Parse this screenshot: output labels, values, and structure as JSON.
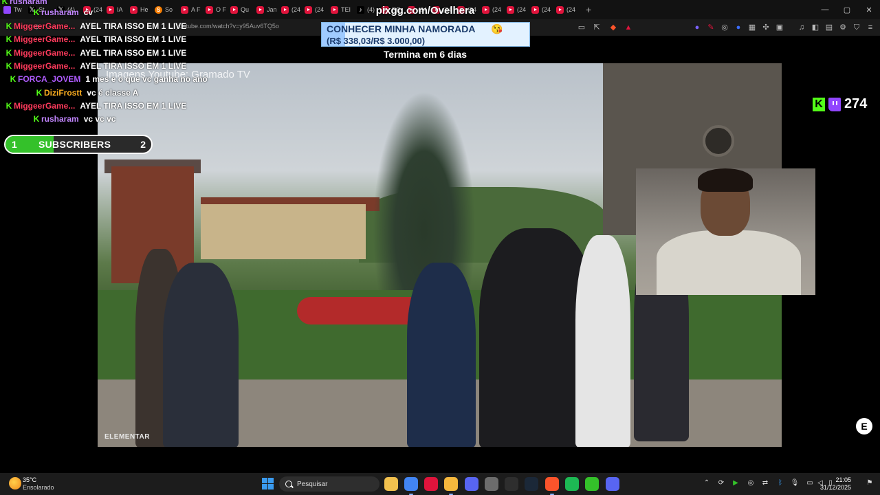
{
  "browser": {
    "tabs": [
      {
        "icon": "tw",
        "label": "Tw"
      },
      {
        "icon": "x",
        "label": "St"
      },
      {
        "icon": "x",
        "label": "(4)"
      },
      {
        "icon": "yt",
        "label": "(24"
      },
      {
        "icon": "yt",
        "label": "IA"
      },
      {
        "icon": "yt",
        "label": "He"
      },
      {
        "icon": "s",
        "label": "So"
      },
      {
        "icon": "yt",
        "label": "A F"
      },
      {
        "icon": "yt",
        "label": "O F"
      },
      {
        "icon": "yt",
        "label": "Qu"
      },
      {
        "icon": "yt",
        "label": "Jan"
      },
      {
        "icon": "yt",
        "label": "(24"
      },
      {
        "icon": "yt",
        "label": "(24"
      },
      {
        "icon": "yt",
        "label": "TEI"
      },
      {
        "icon": "tt",
        "label": "(4)"
      },
      {
        "icon": "yt",
        "label": "RE"
      },
      {
        "icon": "yt",
        "label": "(24"
      },
      {
        "icon": "yt",
        "label": "(24"
      },
      {
        "icon": "yt",
        "label": "(24"
      },
      {
        "icon": "yt",
        "label": "(24"
      },
      {
        "icon": "yt",
        "label": "(24"
      },
      {
        "icon": "yt",
        "label": "(24"
      },
      {
        "icon": "yt",
        "label": "(24"
      }
    ],
    "new_tab": "+",
    "url": "youtube.com/watch?v=y95Auv6TQ5o",
    "window_controls": {
      "minimize": "—",
      "maximize": "▢",
      "close": "✕"
    }
  },
  "overlay": {
    "pixgg": "pixgg.com/Ovelhera",
    "goal_title": "CONHECER MINHA NAMORADA",
    "goal_emoji": "😘",
    "goal_amount": "(R$ 338,03/R$ 3.000,00)",
    "goal_progress": 0.113,
    "ends": "Termina em 6 dias",
    "video_credit": "Imagens Youtube: Gramado TV",
    "video_watermark": "ELEMENTAR",
    "subs_left": "1",
    "subs_label": "SUBSCRIBERS",
    "subs_right": "2",
    "subs_progress": 0.33,
    "viewer_count": "274",
    "corner_badge": "E"
  },
  "chat": [
    {
      "indent": 0,
      "user": "rusharam",
      "msg": "",
      "color": "#c084fc"
    },
    {
      "indent": 46,
      "user": "rusharam",
      "msg": "cv",
      "color": "#c084fc"
    },
    {
      "indent": 6,
      "user": "MiggeerGame...",
      "msg": "AYEL TIRA ISSO EM 1 LIVE",
      "color": "#ff3b5c"
    },
    {
      "indent": 6,
      "user": "MiggeerGame...",
      "msg": "AYEL TIRA ISSO EM 1 LIVE",
      "color": "#ff3b5c"
    },
    {
      "indent": 6,
      "user": "MiggeerGame...",
      "msg": "AYEL TIRA ISSO EM 1 LIVE",
      "color": "#ff3b5c"
    },
    {
      "indent": 6,
      "user": "MiggeerGame...",
      "msg": "AYEL TIRA ISSO EM 1 LIVE",
      "color": "#ff3b5c"
    },
    {
      "indent": 12,
      "user": "FORCA_JOVEM",
      "msg": "1 mes e o que vc ganha no ano",
      "color": "#b05cff"
    },
    {
      "indent": 50,
      "user": "DiziFrostt",
      "msg": "vc é classe A",
      "color": "#ffb020"
    },
    {
      "indent": 6,
      "user": "MiggeerGame...",
      "msg": "AYEL TIRA ISSO EM 1 LIVE",
      "color": "#ff3b5c"
    },
    {
      "indent": 46,
      "user": "rusharam",
      "msg": "vc vc vc",
      "color": "#c084fc"
    }
  ],
  "taskbar": {
    "weather_temp": "35°C",
    "weather_desc": "Ensolarado",
    "search_placeholder": "Pesquisar",
    "time": "21:05",
    "date": "31/12/2025",
    "apps": [
      {
        "name": "file-explorer-icon",
        "color": "#f2c14e"
      },
      {
        "name": "chrome-icon",
        "color": "#4285f4"
      },
      {
        "name": "opera-icon",
        "color": "#e0143c"
      },
      {
        "name": "files-icon",
        "color": "#f5b83d"
      },
      {
        "name": "discord-app-icon",
        "color": "#5865f2"
      },
      {
        "name": "clock-app-icon",
        "color": "#6c6c6c"
      },
      {
        "name": "arrow-app-icon",
        "color": "#2e2e2e"
      },
      {
        "name": "steam-icon",
        "color": "#1b2838"
      },
      {
        "name": "brave-icon",
        "color": "#fb542b"
      },
      {
        "name": "spotify-icon",
        "color": "#1db954"
      },
      {
        "name": "play-app-icon",
        "color": "#34c12a"
      },
      {
        "name": "discord-icon",
        "color": "#5865f2"
      }
    ]
  },
  "colors": {
    "kick": "#53fc18",
    "twitch": "#9146ff",
    "accent": "#8ab4ff"
  }
}
